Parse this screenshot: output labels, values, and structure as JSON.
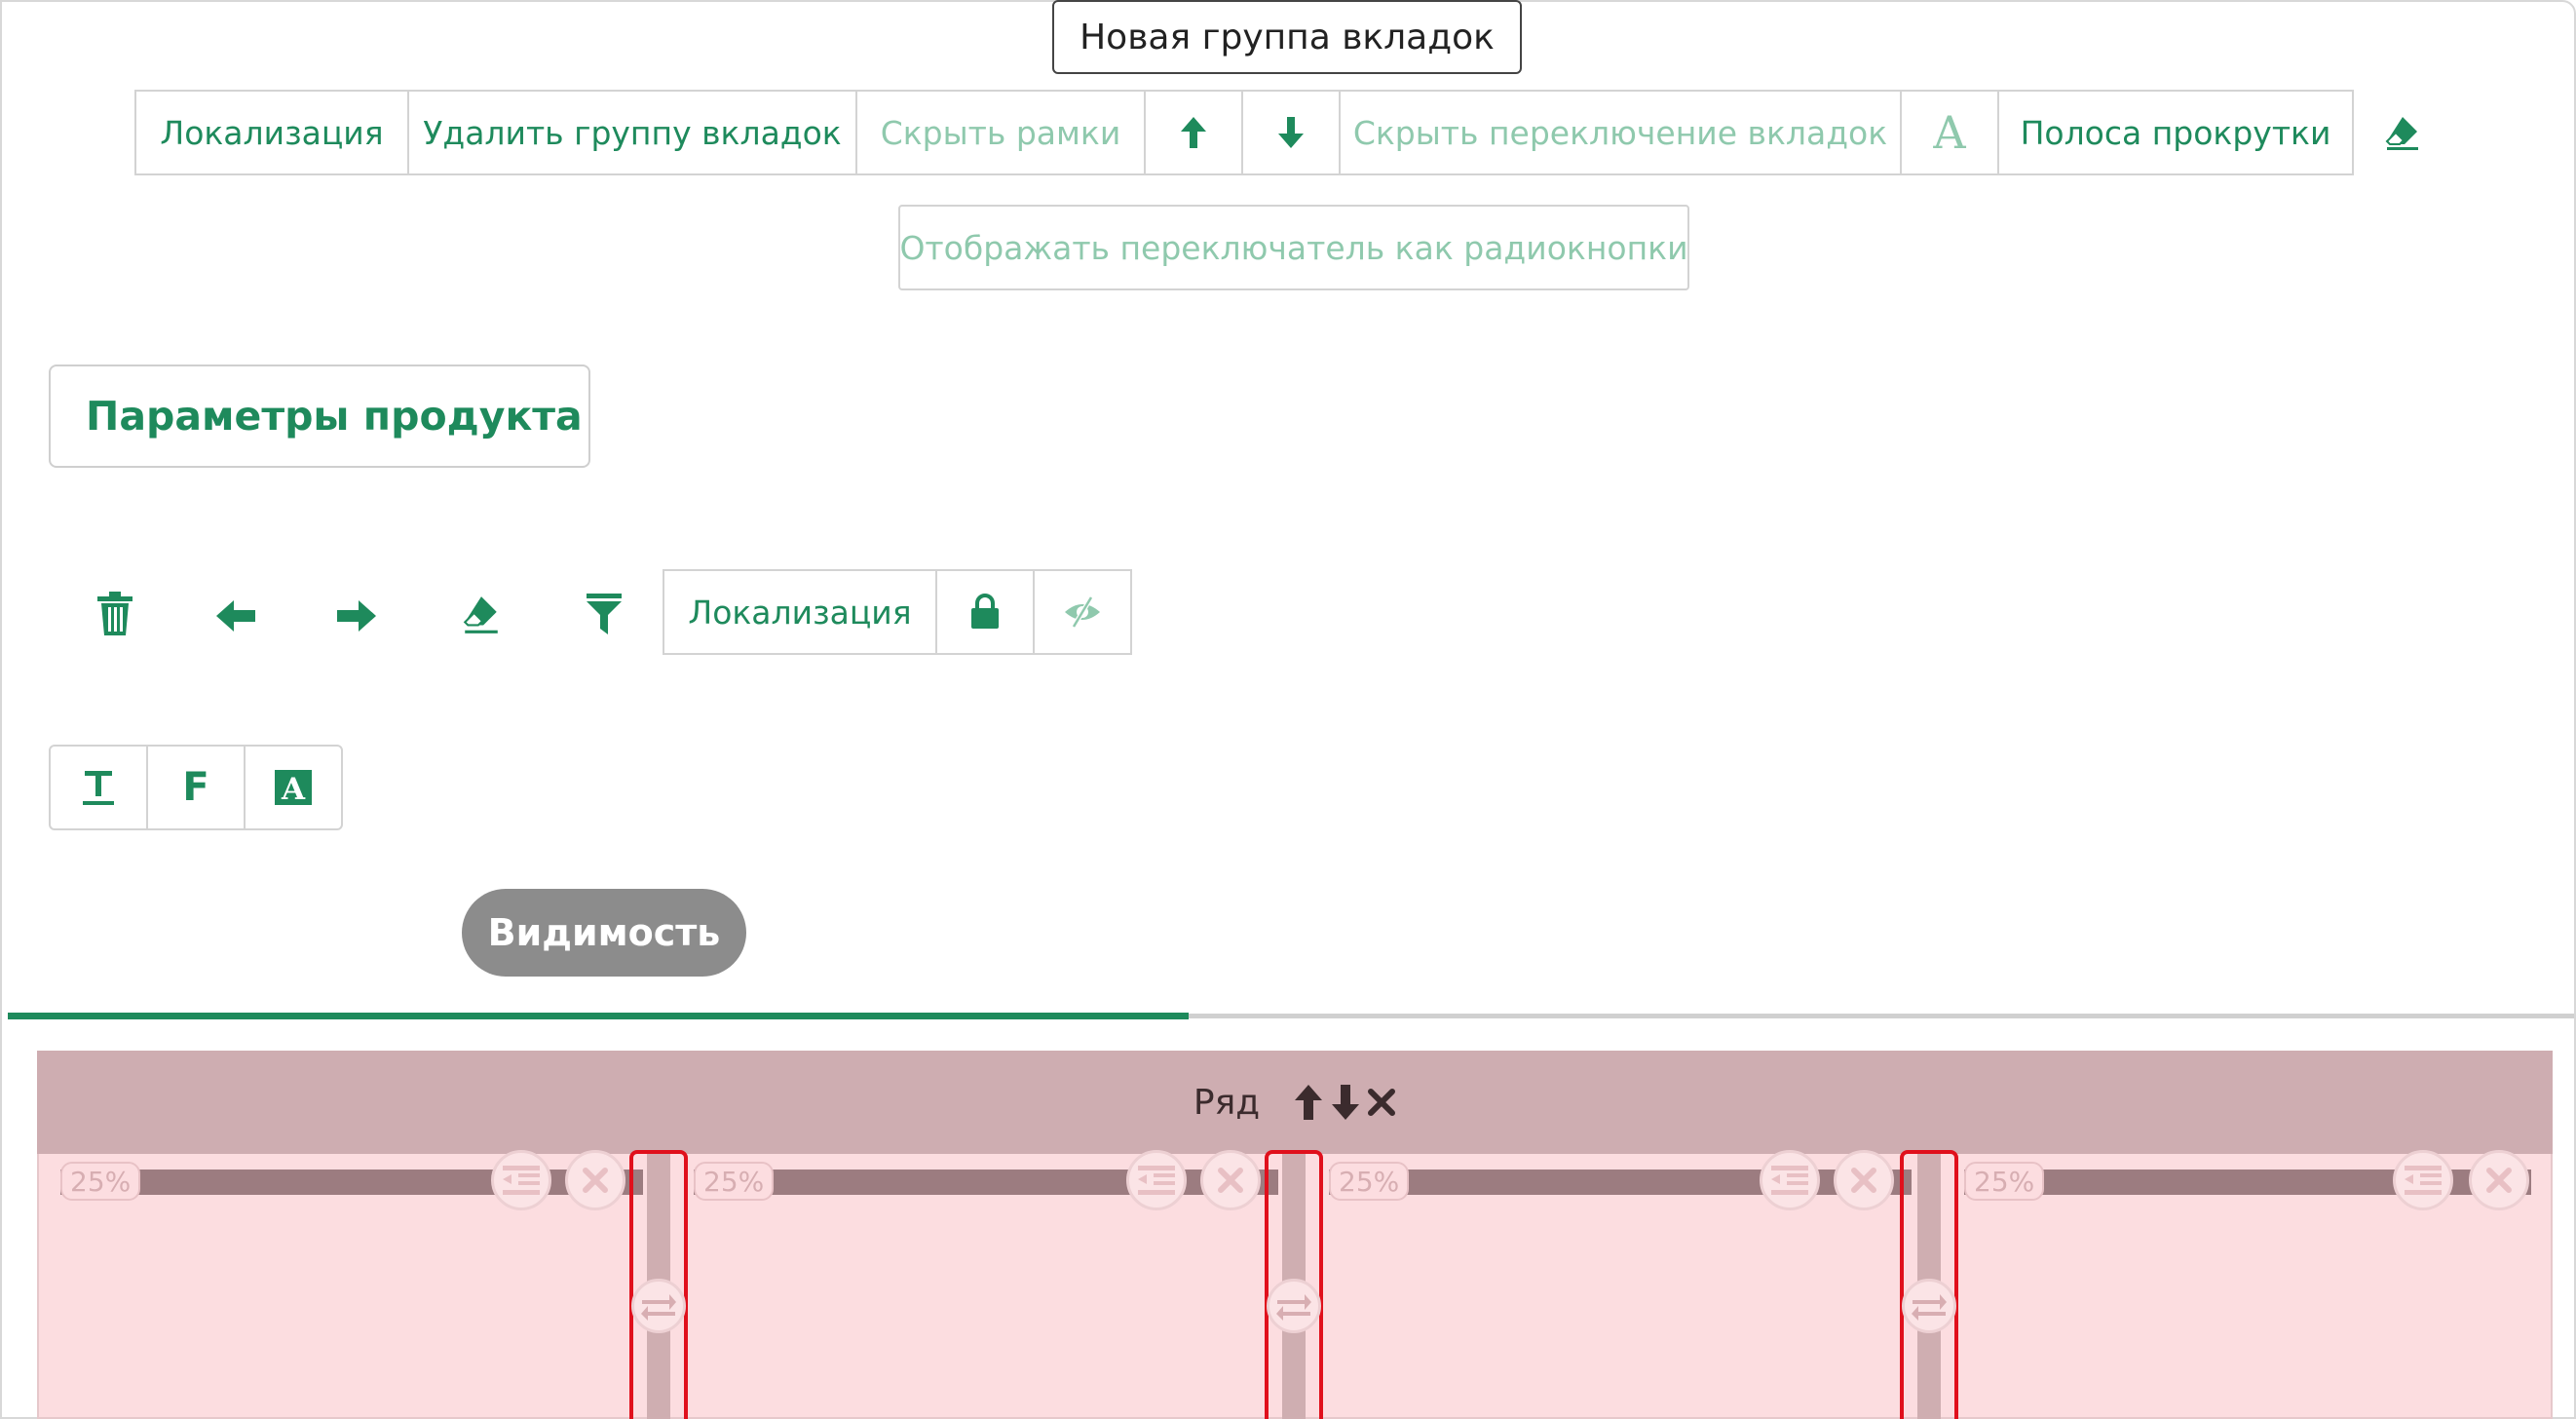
{
  "tab_group": {
    "title": "Новая группа вкладок",
    "toolbar": {
      "localization": "Локализация",
      "delete_group": "Удалить группу вкладок",
      "hide_borders": "Скрыть рамки",
      "move_up_icon": "arrow-up-icon",
      "move_down_icon": "arrow-down-icon",
      "hide_tab_switch": "Скрыть переключение вкладок",
      "font_icon": "font-A-icon",
      "scrollbar": "Полоса прокрутки",
      "eraser_icon": "eraser-icon"
    },
    "radio_toggle": "Отображать переключатель как радиокнопки"
  },
  "section": {
    "title": "Параметры продукта",
    "actions": {
      "icons": [
        "trash-icon",
        "arrow-left-icon",
        "arrow-right-icon",
        "eraser-icon",
        "filter-icon"
      ],
      "localization": "Локализация",
      "lock_icon": "lock-icon",
      "hidden_icon": "eye-slash-icon"
    },
    "text_format": {
      "text_icon": "text-format-icon",
      "F": "F",
      "A_icon": "highlight-A-icon"
    },
    "visibility": "Видимость"
  },
  "progress": {
    "fraction": 0.46
  },
  "row": {
    "label": "Ряд",
    "columns": [
      {
        "width_label": "25%"
      },
      {
        "width_label": "25%"
      },
      {
        "width_label": "25%"
      },
      {
        "width_label": "25%"
      }
    ]
  },
  "colors": {
    "accent": "#1e8a5c",
    "accent_dim": "#8fc9ad",
    "row_header": "#ceadb1",
    "row_body": "#fcdde0",
    "divider_highlight": "#e0101c",
    "visibility_pill": "#8c8c8c"
  }
}
